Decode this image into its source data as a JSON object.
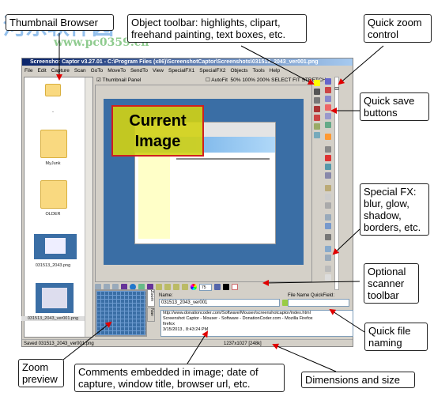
{
  "watermark": {
    "cn": "河东软件园",
    "url": "www.pc0359.cn"
  },
  "window": {
    "title": "Screenshot Captor v3.27.01 - C:\\Program Files (x86)\\ScreenshotCaptor\\Screenshots\\031513_2043_ver001.png",
    "menu": [
      "File",
      "Edit",
      "Capture",
      "Scan",
      "GoTo",
      "MoveTo",
      "SendTo",
      "View",
      "SpecialFX1",
      "SpecialFX2",
      "Objects",
      "Tools",
      "Help"
    ],
    "thumbnail_panel_label": "Thumbnail Panel",
    "autofit_label": "AutoFit",
    "zoom_options": "50%  100%  200%  SELECT  FIT  STRETCH",
    "thumbnails": [
      {
        "label": ".."
      },
      {
        "label": "MyJunk"
      },
      {
        "label": "OLDER"
      },
      {
        "label": "031513_2043.png"
      },
      {
        "label": "031513_2043_ver001.png",
        "selected": true
      }
    ],
    "current_image_label": "Current Image",
    "scanner_zoom_value": "75",
    "zoom_tab": "Zoom",
    "nav_tab": "Nav",
    "name_label": "Name:",
    "name_value": "031513_2043_ver001",
    "quickfield_label": "File Name QuickField:",
    "quickfield_value": "",
    "comments": [
      "http://www.donationcoder.com/Software/Mouser/screenshotcaptor/index.html",
      "Screenshot Captor - Mouser - Software - DonationCoder.com - Mozilla Firefox",
      "firefox",
      "3/15/2013 , 8:43:24 PM"
    ],
    "status_left": "Saved 031513_2043_ver001.png",
    "status_dims": "1237x1027  [248k]"
  },
  "callouts": {
    "thumbnail_browser": "Thumbnail Browser",
    "object_toolbar": "Object toolbar: highlights, clipart, freehand painting, text boxes, etc.",
    "quick_zoom": "Quick zoom control",
    "quick_save": "Quick save buttons",
    "special_fx": "Special FX: blur, glow, shadow, borders, etc.",
    "scanner": "Optional scanner toolbar",
    "file_naming": "Quick file naming",
    "zoom_preview": "Zoom preview",
    "comments": "Comments embedded in image; date of capture, window title, browser url, etc.",
    "dimensions": "Dimensions and size"
  },
  "colors": {
    "arrow": "#e00000",
    "title_bar": "#0a246a",
    "image_bg": "#3a6ea5",
    "highlight": "#d2d214"
  }
}
